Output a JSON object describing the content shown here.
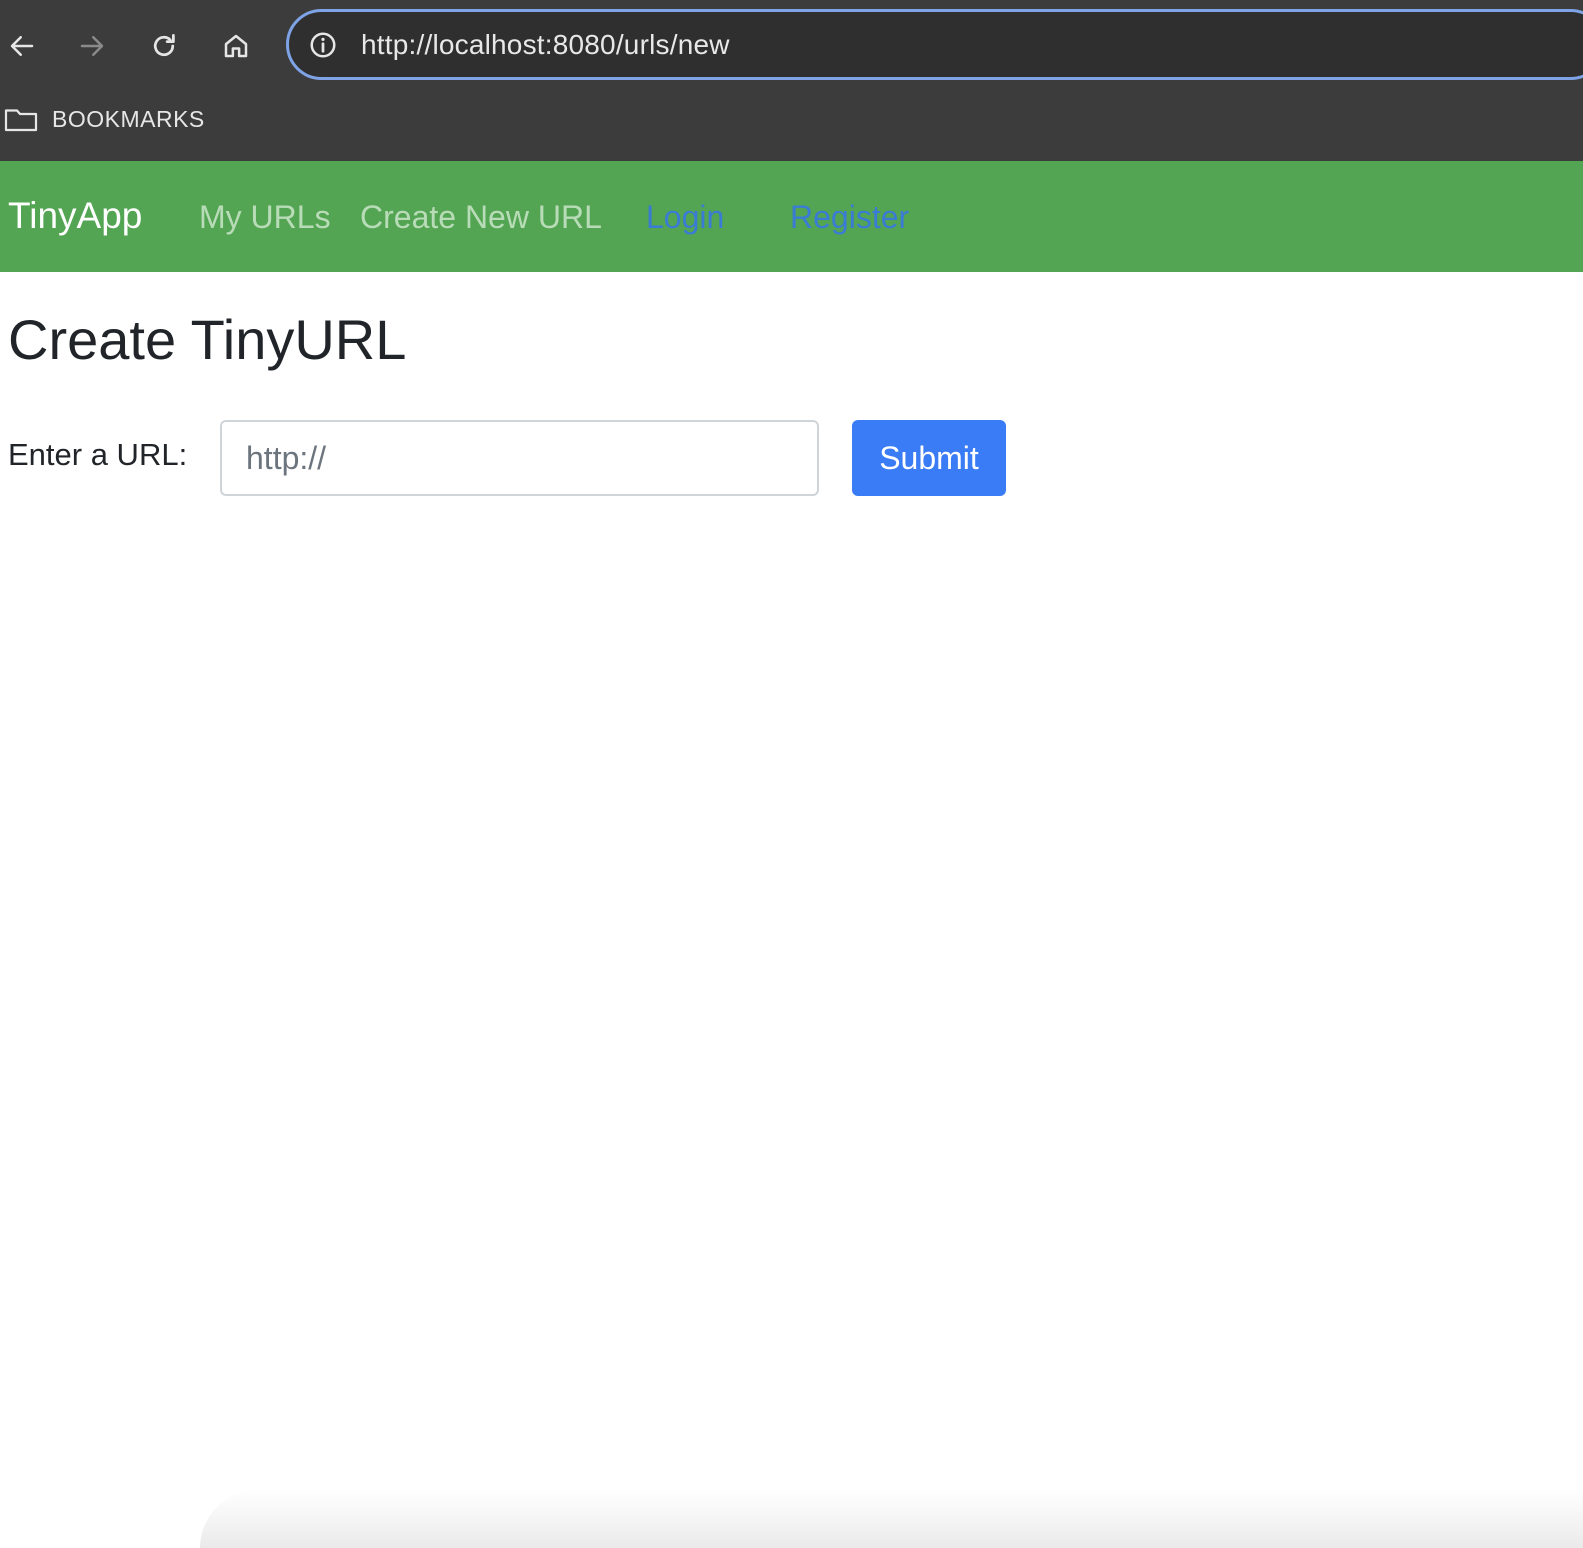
{
  "browser": {
    "address": "http://localhost:8080/urls/new",
    "bookmarks_label": "BOOKMARKS"
  },
  "navbar": {
    "brand": "TinyApp",
    "links": {
      "my_urls": "My URLs",
      "create_new": "Create New URL",
      "login": "Login",
      "register": "Register"
    }
  },
  "main": {
    "title": "Create TinyURL",
    "form": {
      "label": "Enter a URL:",
      "input_placeholder": "http://",
      "input_value": "",
      "submit_label": "Submit"
    }
  },
  "colors": {
    "chrome_bg": "#3c3c3c",
    "address_border": "#7ea3e6",
    "navbar_bg": "#54a553",
    "muted_link": "#b9dcb8",
    "auth_link": "#3a7bd5",
    "submit_bg": "#3a7bf6"
  },
  "icons": {
    "back": "arrow-left-icon",
    "forward": "arrow-right-icon",
    "reload": "reload-icon",
    "home": "home-icon",
    "site_info": "info-circle-icon",
    "bookmarks": "folder-icon"
  }
}
